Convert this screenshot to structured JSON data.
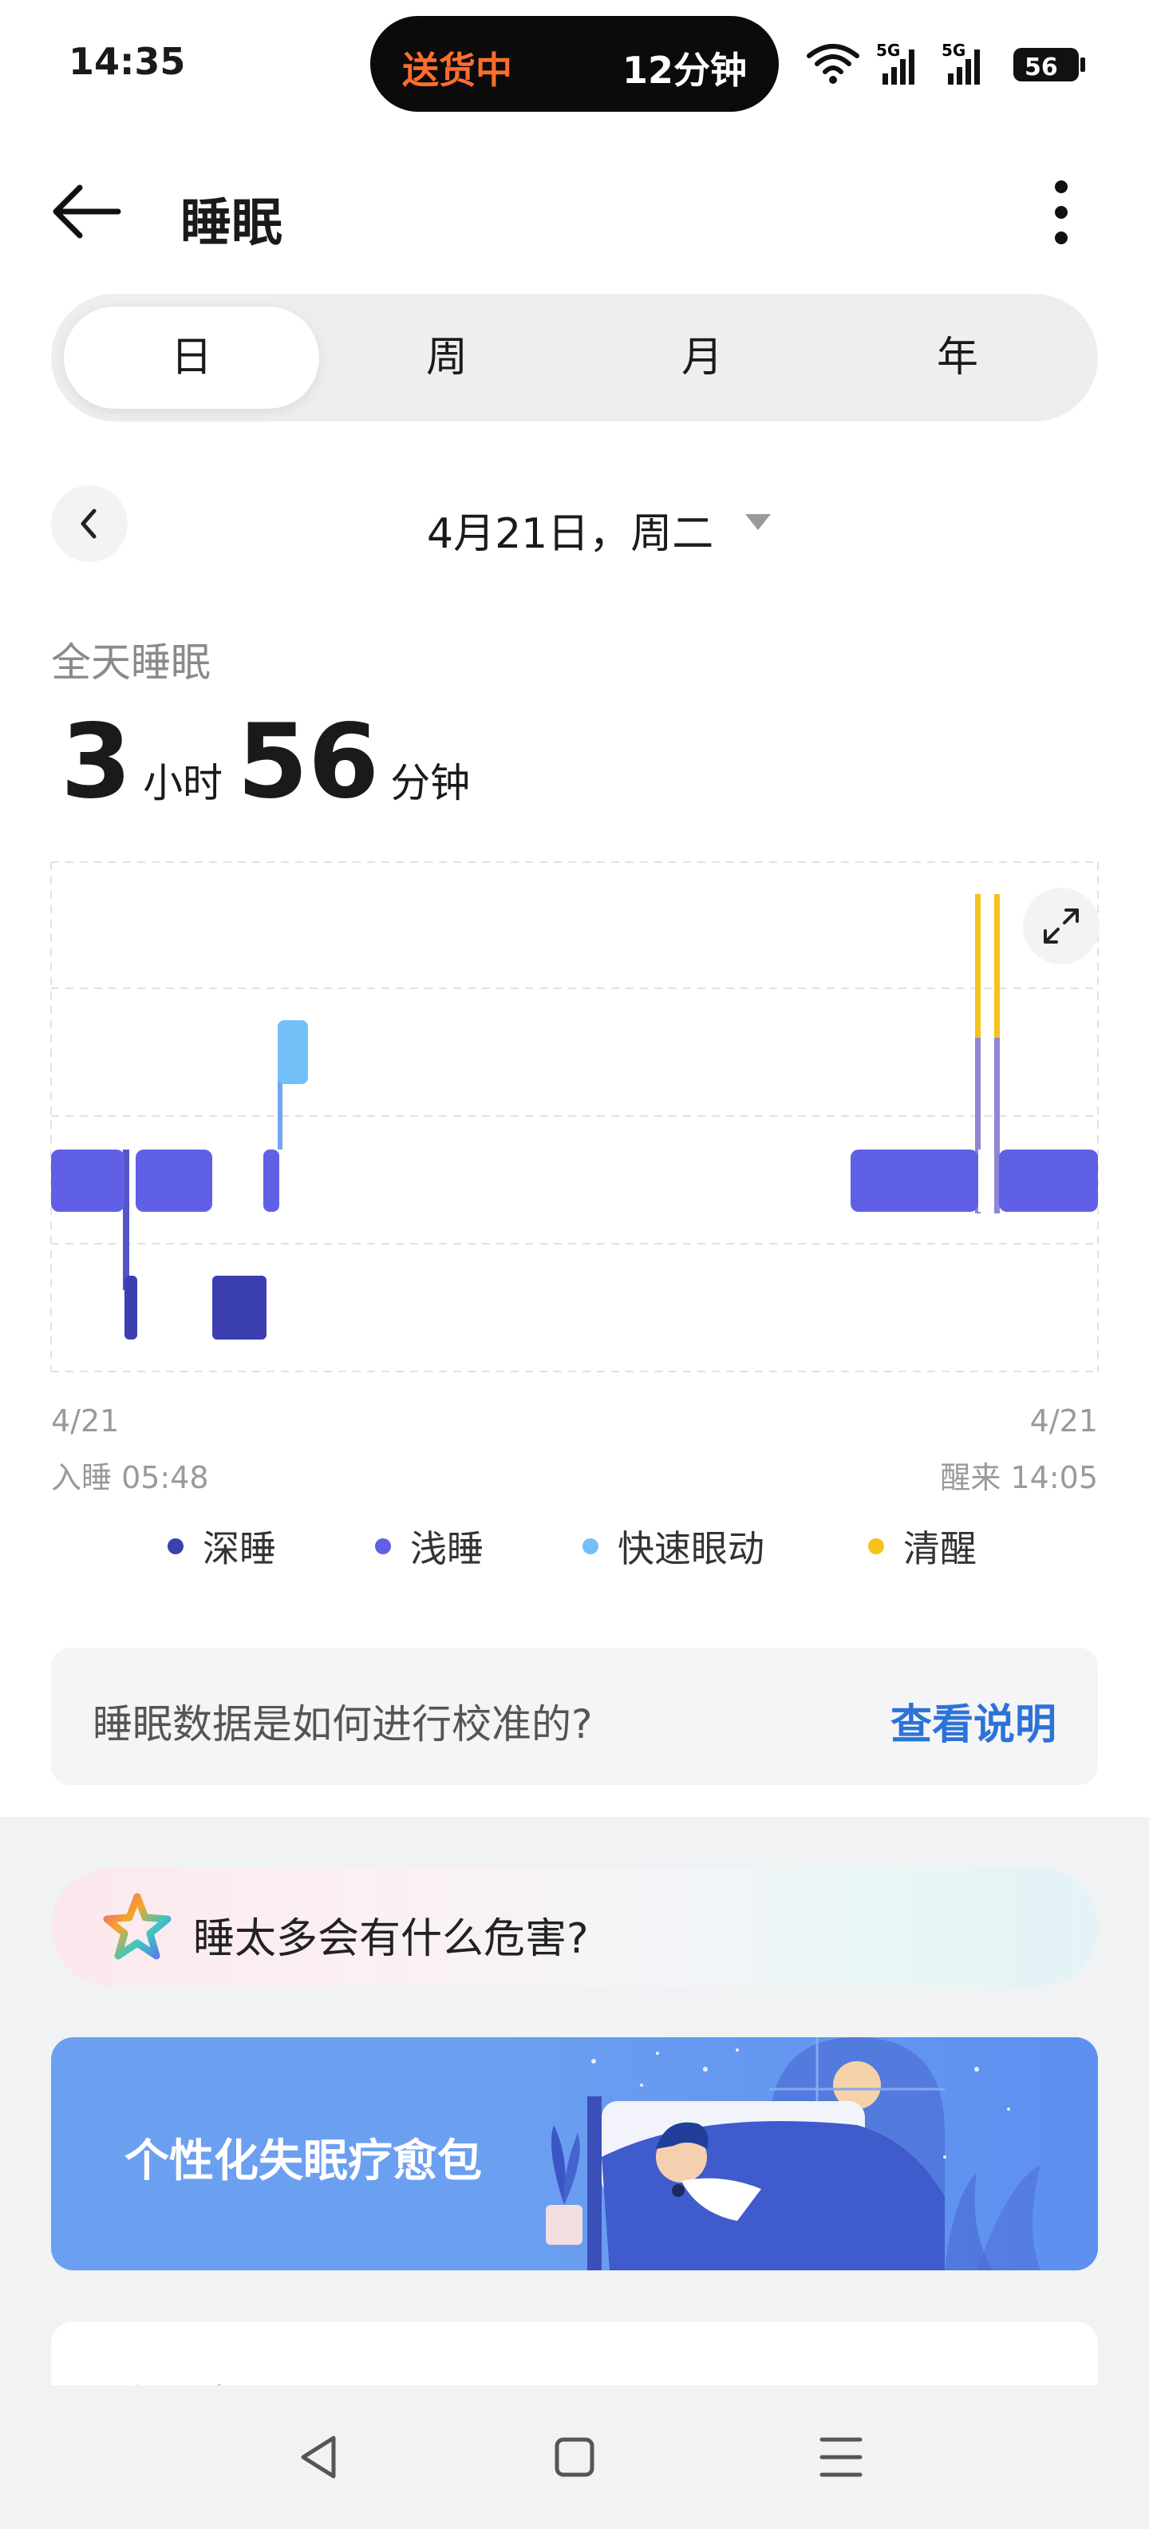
{
  "status": {
    "time": "14:35",
    "delivery_status": "送货中",
    "delivery_eta": "12分钟",
    "battery": "56",
    "network_1": "5G",
    "network_2": "5G"
  },
  "header": {
    "title": "睡眠"
  },
  "tabs": [
    {
      "label": "日",
      "active": true
    },
    {
      "label": "周",
      "active": false
    },
    {
      "label": "月",
      "active": false
    },
    {
      "label": "年",
      "active": false
    }
  ],
  "date": {
    "label": "4月21日，周二"
  },
  "summary": {
    "label": "全天睡眠",
    "hours": "3",
    "hours_unit": "小时",
    "minutes": "56",
    "minutes_unit": "分钟"
  },
  "chart_data": {
    "type": "timeline",
    "x_start": {
      "date": "4/21",
      "label": "入睡 05:48"
    },
    "x_end": {
      "date": "4/21",
      "label": "醒来 14:05"
    },
    "stages": [
      {
        "key": "deep",
        "name": "深睡",
        "color": "#3b3fb0"
      },
      {
        "key": "light",
        "name": "浅睡",
        "color": "#6060e6"
      },
      {
        "key": "rem",
        "name": "快速眼动",
        "color": "#72c0f7"
      },
      {
        "key": "awake",
        "name": "清醒",
        "color": "#f5c21b"
      }
    ]
  },
  "legend": [
    "深睡",
    "浅睡",
    "快速眼动",
    "清醒"
  ],
  "info_card": {
    "question": "睡眠数据是如何进行校准的?",
    "link": "查看说明"
  },
  "question_banner": {
    "text": "睡太多会有什么危害?"
  },
  "promo": {
    "text": "个性化失眠疗愈包"
  },
  "quality_card": {
    "title": "睡眠质量"
  },
  "colors": {
    "accent_link": "#2c73d8",
    "deep": "#3b3fb0",
    "light": "#6060e6",
    "rem": "#72c0f7",
    "awake": "#f5c21b",
    "promo_bg": "#6b9ff0"
  }
}
